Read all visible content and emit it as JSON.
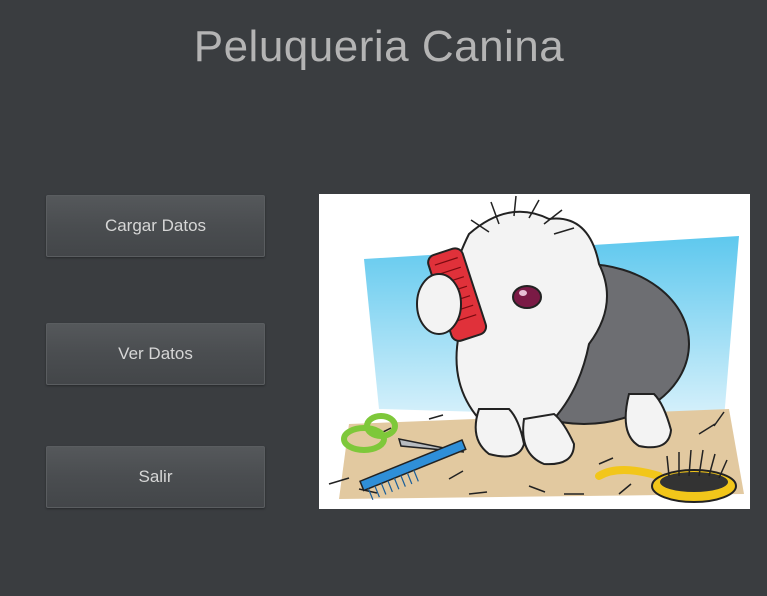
{
  "window": {
    "title": "Peluqueria Canina"
  },
  "buttons": {
    "load": "Cargar Datos",
    "view": "Ver Datos",
    "exit": "Salir"
  },
  "illustration": {
    "icon": "grooming-dog-illustration",
    "colors": {
      "background": "#3a3d40",
      "title": "#b4b4b4",
      "button_text": "#d6d6d6",
      "sky": "#5ec8ee",
      "floor": "#e2c9a0",
      "fur_gray": "#6d6e72",
      "fur_white": "#f3f3f3",
      "comb_red": "#e0313a",
      "scissors_green": "#7ec83a",
      "comb_blue": "#2f8fd8",
      "brush_yellow": "#f2c61a"
    }
  }
}
